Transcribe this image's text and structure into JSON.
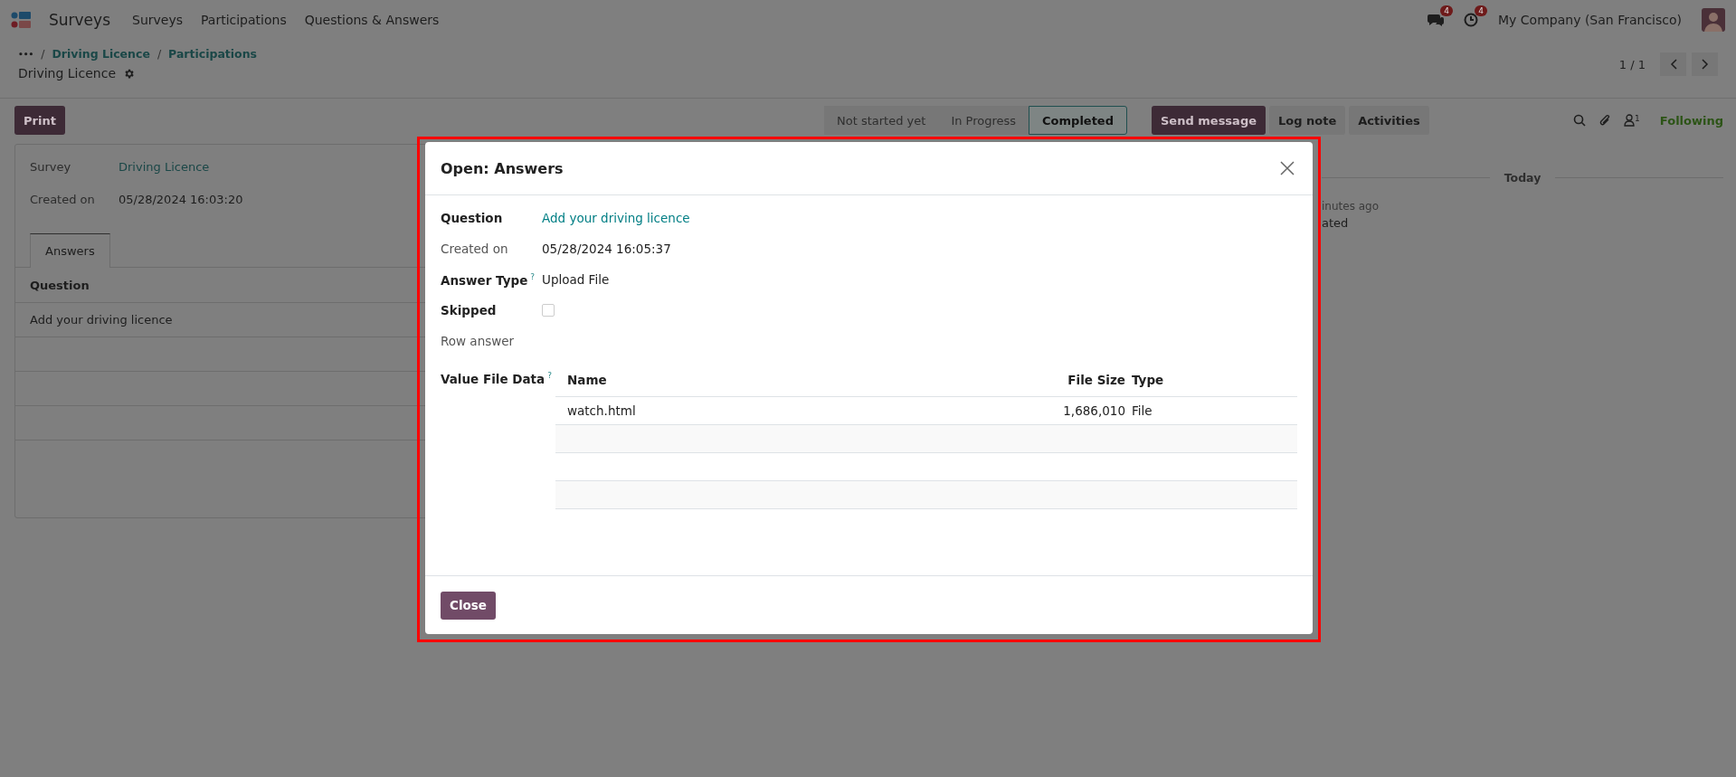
{
  "navbar": {
    "app_name": "Surveys",
    "menu": [
      "Surveys",
      "Participations",
      "Questions & Answers"
    ],
    "messages_badge": "4",
    "activities_badge": "4",
    "company": "My Company (San Francisco)"
  },
  "breadcrumb": {
    "ellipsis": "•••",
    "separator": "/",
    "items": [
      "Driving Licence",
      "Participations"
    ],
    "title": "Driving Licence"
  },
  "pager": {
    "text": "1 / 1"
  },
  "print_button": "Print",
  "statusbar": [
    {
      "label": "Not started yet",
      "selected": false
    },
    {
      "label": "In Progress",
      "selected": false
    },
    {
      "label": "Completed",
      "selected": true
    }
  ],
  "chatter": {
    "buttons": [
      "Send message",
      "Log note",
      "Activities"
    ],
    "followers_count": "1",
    "following": "Following",
    "day": "Today",
    "time": "inutes ago",
    "body": "ated"
  },
  "form": {
    "fields": [
      {
        "label": "Survey",
        "value": "Driving Licence",
        "kind": "link"
      },
      {
        "label": "Created on",
        "value": "05/28/2024 16:03:20",
        "kind": "text"
      }
    ],
    "tabs": [
      {
        "label": "Answers",
        "selected": true
      }
    ],
    "table": {
      "columns": [
        "Question"
      ],
      "rows": [
        "Add your driving licence"
      ]
    }
  },
  "dialog": {
    "title": "Open: Answers",
    "fields": [
      {
        "label": "Question",
        "value": "Add your driving licence",
        "kind": "link",
        "bold": true
      },
      {
        "label": "Created on",
        "value": "05/28/2024 16:05:37",
        "kind": "text",
        "bold": false
      },
      {
        "label": "Answer Type",
        "help": "?",
        "value": "Upload File",
        "kind": "text",
        "bold": true
      },
      {
        "label": "Skipped",
        "kind": "checkbox",
        "checked": false,
        "bold": true
      },
      {
        "label": "Row answer",
        "kind": "empty",
        "bold": false
      }
    ],
    "file_field": {
      "label": "Value File Data",
      "help": "?",
      "columns": [
        "Name",
        "File Size",
        "Type"
      ],
      "rows": [
        [
          "watch.html",
          "1,686,010",
          "File"
        ]
      ]
    },
    "close_button": "Close"
  }
}
